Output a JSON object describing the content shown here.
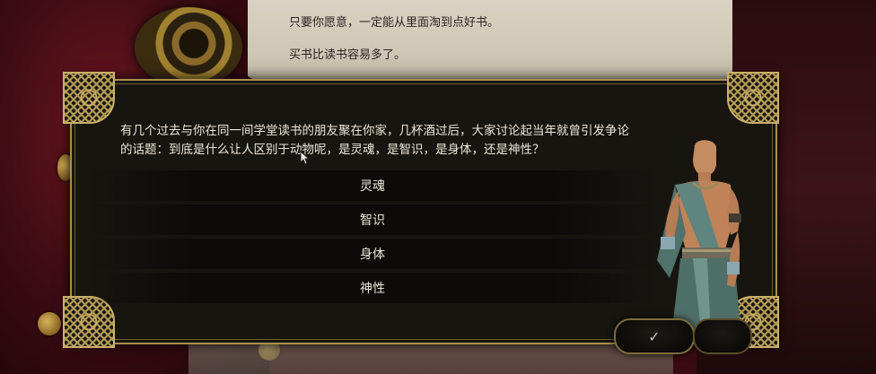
{
  "background_note": {
    "line1": "只要你愿意，一定能从里面淘到点好书。",
    "line2": "买书比读书容易多了。"
  },
  "dialog": {
    "question": "有几个过去与你在同一间学堂读书的朋友聚在你家，几杯酒过后，大家讨论起当年就曾引发争论的话题：到底是什么让人区别于动物呢，是灵魂，是智识，是身体，还是神性？",
    "options": [
      {
        "label": "灵魂"
      },
      {
        "label": "智识"
      },
      {
        "label": "身体"
      },
      {
        "label": "神性"
      }
    ],
    "confirm_icon": "checkmark-icon",
    "confirm_glyph": "✓"
  },
  "colors": {
    "frame_gold": "#a8904e",
    "panel_bg": "#171510",
    "text": "#ece6d8",
    "backdrop_red": "#3a0c12"
  }
}
